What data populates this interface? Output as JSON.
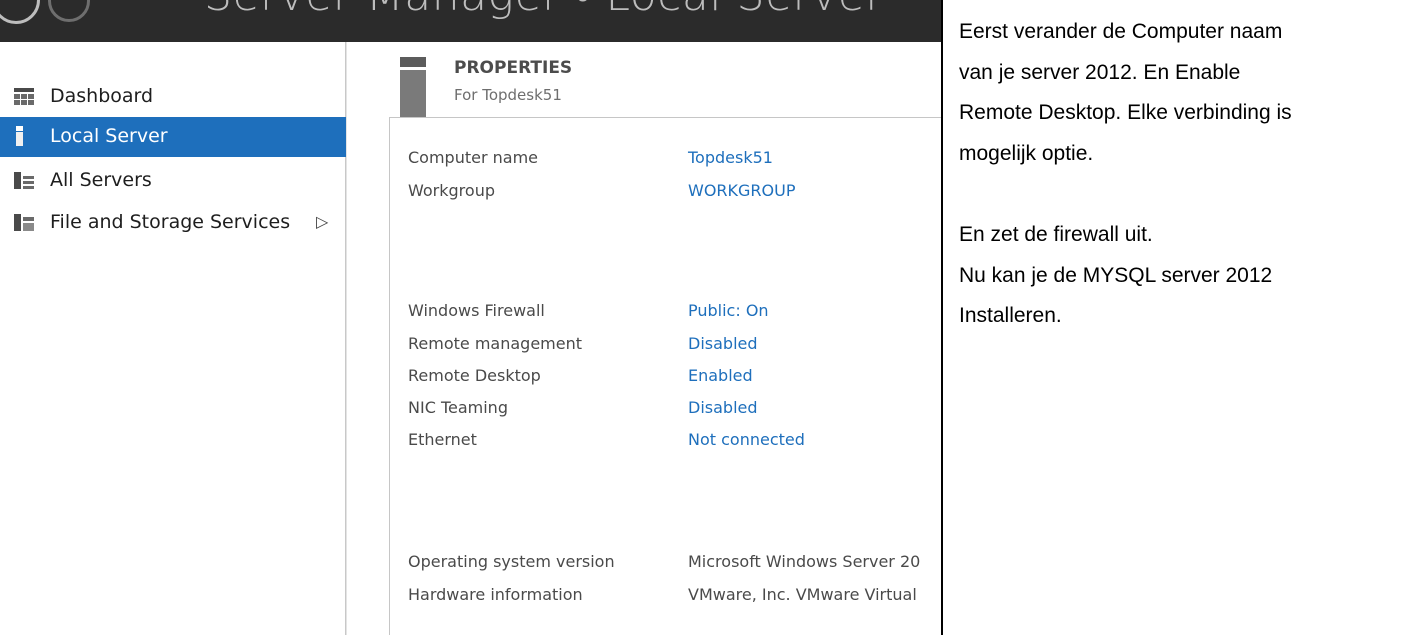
{
  "window": {
    "title": "Server Manager • Local Server"
  },
  "sidebar": {
    "items": [
      {
        "label": "Dashboard",
        "icon": "dashboard-icon",
        "active": false
      },
      {
        "label": "Local Server",
        "icon": "local-server-icon",
        "active": true
      },
      {
        "label": "All Servers",
        "icon": "all-servers-icon",
        "active": false
      },
      {
        "label": "File and Storage Services",
        "icon": "file-storage-icon",
        "active": false,
        "expand": "▷"
      }
    ]
  },
  "properties": {
    "heading": "PROPERTIES",
    "subheading": "For Topdesk51",
    "rows": [
      {
        "label": "Computer name",
        "value": "Topdesk51",
        "link": true
      },
      {
        "label": "Workgroup",
        "value": "WORKGROUP",
        "link": true
      },
      {
        "label": "Windows Firewall",
        "value": "Public: On",
        "link": true
      },
      {
        "label": "Remote management",
        "value": "Disabled",
        "link": true
      },
      {
        "label": "Remote Desktop",
        "value": "Enabled",
        "link": true
      },
      {
        "label": "NIC Teaming",
        "value": "Disabled",
        "link": true
      },
      {
        "label": "Ethernet",
        "value": "Not connected",
        "link": true
      },
      {
        "label": "Operating system version",
        "value": "Microsoft Windows Server 20",
        "link": false
      },
      {
        "label": "Hardware information",
        "value": "VMware, Inc. VMware Virtual",
        "link": false
      }
    ]
  },
  "note": {
    "lines": [
      "Eerst verander de Computer naam",
      "van je server 2012. En Enable",
      "Remote Desktop. Elke verbinding is",
      "mogelijk optie.",
      "En zet de firewall uit.",
      "Nu kan je de MYSQL server 2012",
      "Installeren."
    ]
  },
  "colors": {
    "accent": "#1e6fbc",
    "titlebar": "#2b2b2b"
  }
}
